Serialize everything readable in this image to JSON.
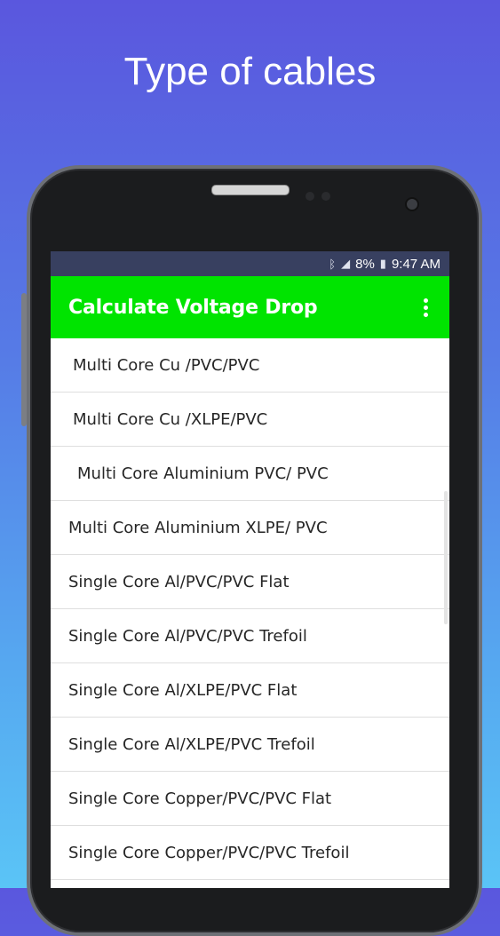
{
  "headline": "Type of cables",
  "status": {
    "bluetooth_icon": "bluetooth-icon",
    "signal_icon": "signal-icon",
    "battery_percent": "8%",
    "battery_icon": "battery-icon",
    "time": "9:47 AM"
  },
  "appbar": {
    "title": "Calculate Voltage Drop",
    "menu_icon": "overflow-menu-icon",
    "color": "#00e400"
  },
  "cable_list": [
    {
      "label": "Multi Core Cu /PVC/PVC"
    },
    {
      "label": "Multi Core Cu /XLPE/PVC"
    },
    {
      "label": "Multi Core Aluminium PVC/ PVC"
    },
    {
      "label": "Multi Core Aluminium XLPE/ PVC"
    },
    {
      "label": "Single Core Al/PVC/PVC Flat"
    },
    {
      "label": "Single Core Al/PVC/PVC Trefoil"
    },
    {
      "label": "Single Core Al/XLPE/PVC Flat"
    },
    {
      "label": "Single Core Al/XLPE/PVC Trefoil"
    },
    {
      "label": "Single Core Copper/PVC/PVC Flat"
    },
    {
      "label": "Single Core Copper/PVC/PVC Trefoil"
    }
  ]
}
